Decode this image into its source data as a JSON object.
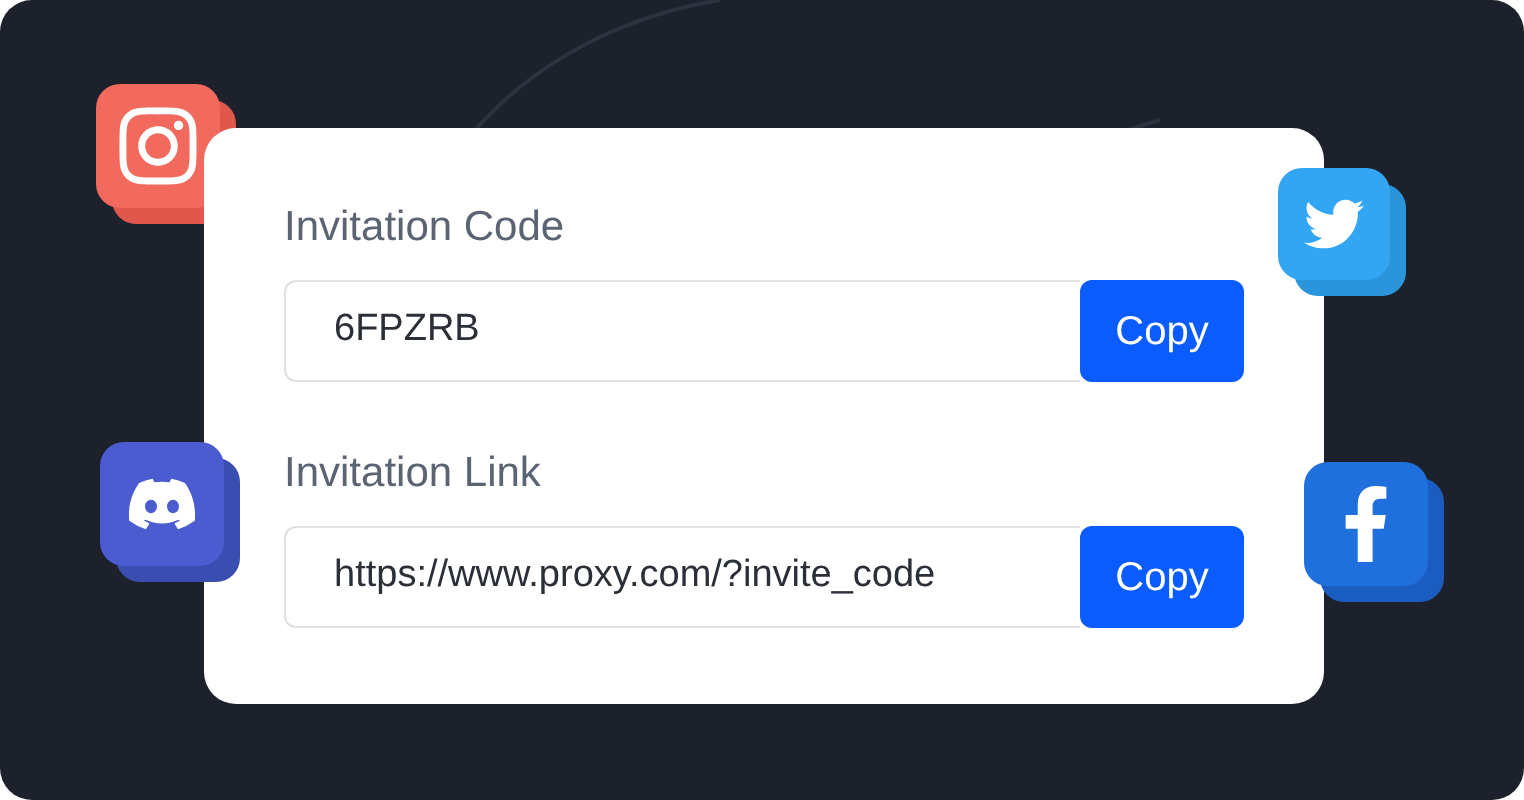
{
  "card": {
    "fields": [
      {
        "label": "Invitation Code",
        "value": "6FPZRB",
        "button": "Copy"
      },
      {
        "label": "Invitation Link",
        "value": "https://www.proxy.com/?invite_code",
        "button": "Copy"
      }
    ]
  }
}
